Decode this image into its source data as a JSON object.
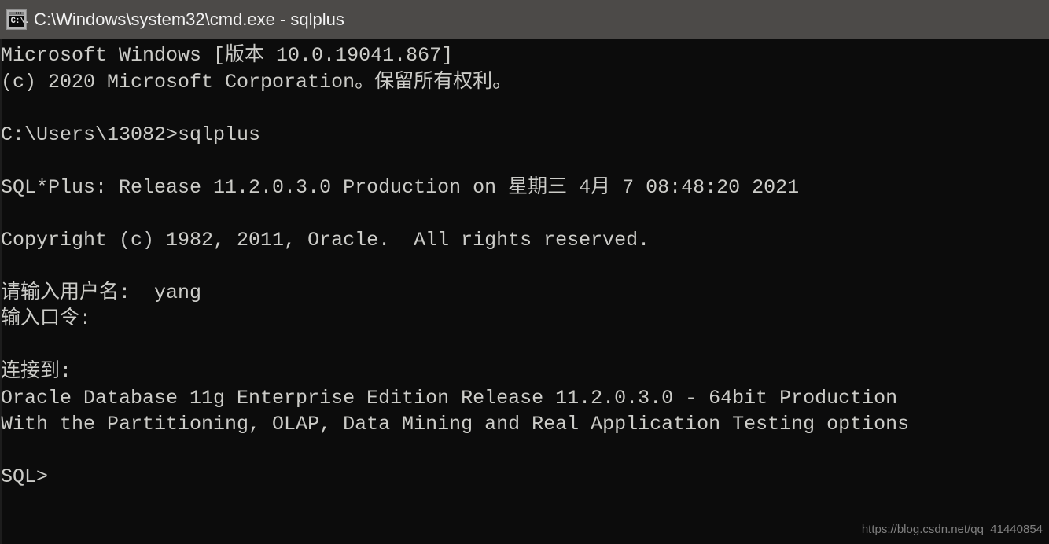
{
  "window": {
    "title": "C:\\Windows\\system32\\cmd.exe - sqlplus",
    "icon": "cmd-console-icon",
    "icon_caption": "C:\\.",
    "titlebar_color": "#4c4a48",
    "console_background": "#0c0c0c",
    "console_foreground": "#ccccc8"
  },
  "console": {
    "lines": [
      "Microsoft Windows [版本 10.0.19041.867]",
      "(c) 2020 Microsoft Corporation。保留所有权利。",
      "",
      "C:\\Users\\13082>sqlplus",
      "",
      "SQL*Plus: Release 11.2.0.3.0 Production on 星期三 4月 7 08:48:20 2021",
      "",
      "Copyright (c) 1982, 2011, Oracle.  All rights reserved.",
      "",
      "请输入用户名:  yang",
      "输入口令:",
      "",
      "连接到:",
      "Oracle Database 11g Enterprise Edition Release 11.2.0.3.0 - 64bit Production",
      "With the Partitioning, OLAP, Data Mining and Real Application Testing options",
      "",
      "SQL>"
    ],
    "prompt": "SQL>",
    "username_entered": "yang",
    "os_version": "10.0.19041.867",
    "sqlplus_release": "11.2.0.3.0",
    "oracle_release": "11.2.0.3.0",
    "session_timestamp": "星期三 4月 7 08:48:20 2021"
  },
  "watermark": {
    "text": "https://blog.csdn.net/qq_41440854"
  }
}
